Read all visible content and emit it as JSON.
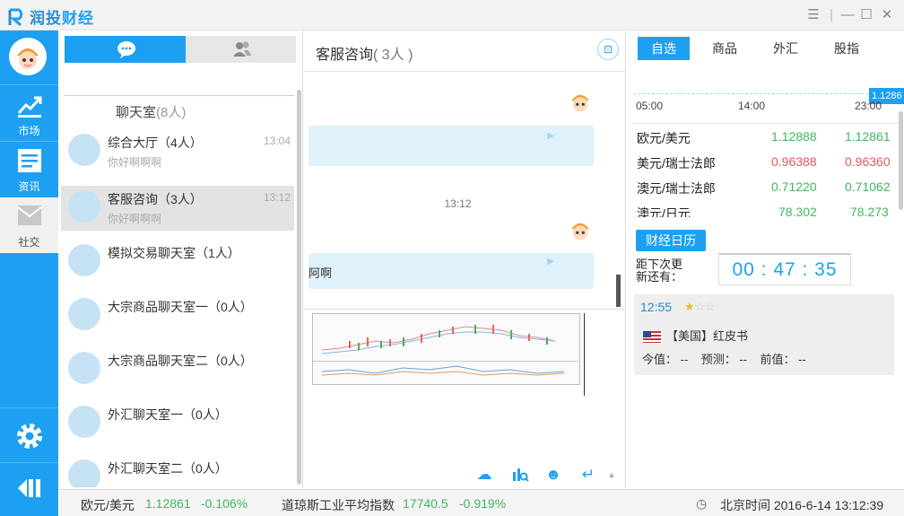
{
  "app": {
    "logo_mark": "R",
    "logo_a": "润投",
    "logo_b": "财经"
  },
  "window_controls": [
    "list-icon",
    "minimize-icon",
    "maximize-icon",
    "close-icon"
  ],
  "nav": {
    "market": "市场",
    "news": "资讯",
    "social": "社交"
  },
  "chatlist": {
    "room_title": "聊天室",
    "room_count": "(8人)",
    "rooms": [
      {
        "name": "综合大厅（4人）",
        "time": "13:04",
        "msg": "你好啊啊啊"
      },
      {
        "name": "客服咨询（3人）",
        "time": "13:12",
        "msg": "你好啊啊啊"
      },
      {
        "name": "模拟交易聊天室（1人）",
        "time": "",
        "msg": ""
      },
      {
        "name": "大宗商品聊天室一（0人）",
        "time": "",
        "msg": ""
      },
      {
        "name": "大宗商品聊天室二（0人）",
        "time": "",
        "msg": ""
      },
      {
        "name": "外汇聊天室一（0人）",
        "time": "",
        "msg": ""
      },
      {
        "name": "外汇聊天室二（0人）",
        "time": "",
        "msg": ""
      }
    ]
  },
  "chat": {
    "title": "客服咨询",
    "count": "( 3人 )",
    "time_divider": "13:12",
    "bubble2_text": "阿啊"
  },
  "right": {
    "tabs": [
      "自选",
      "商品",
      "外汇",
      "股指"
    ],
    "mini_chart": {
      "ticks": [
        "05:00",
        "14:00",
        "23:00"
      ],
      "last_price": "1.1286"
    },
    "quotes": [
      {
        "name": "欧元/美元",
        "bid": "1.12888",
        "ask": "1.12861",
        "color": "#43b55f"
      },
      {
        "name": "美元/瑞士法郎",
        "bid": "0.96388",
        "ask": "0.96360",
        "color": "#e5575a"
      },
      {
        "name": "澳元/瑞士法郎",
        "bid": "0.71220",
        "ask": "0.71062",
        "color": "#43b55f"
      },
      {
        "name": "澳元/日元",
        "bid": "78.302",
        "ask": "78.273",
        "color": "#43b55f"
      }
    ],
    "calendar_button": "财经日历",
    "countdown_label_1": "距下次更",
    "countdown_label_2": "新还有：",
    "countdown": "00 : 47 : 35",
    "event": {
      "time": "12:55",
      "stars": "★☆☆",
      "country": "【美国】红皮书",
      "current": "今值： --",
      "forecast": "预测： --",
      "previous": "前值： --"
    }
  },
  "status": {
    "pair1": "欧元/美元",
    "pair1_price": "1.12861",
    "pair1_change": "-0.106%",
    "pair2": "道琼斯工业平均指数",
    "pair2_price": "17740.5",
    "pair2_change": "-0.919%",
    "time": "北京时间 2016-6-14 13:12:39"
  }
}
